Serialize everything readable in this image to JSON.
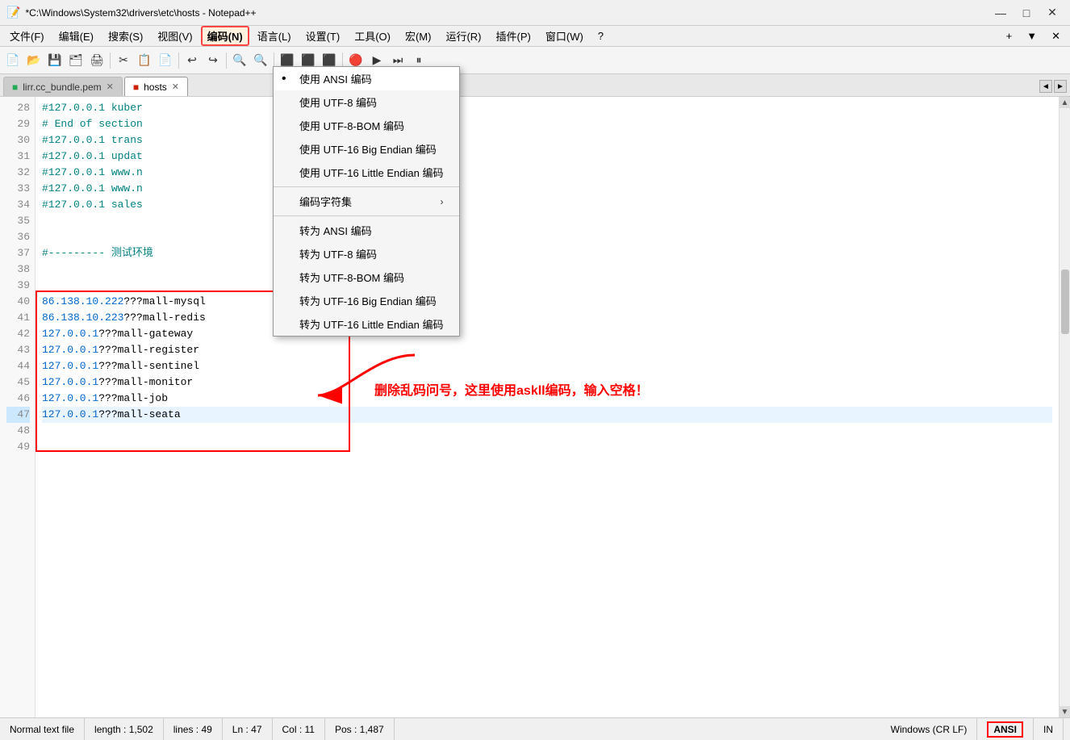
{
  "window": {
    "title": "*C:\\Windows\\System32\\drivers\\etc\\hosts - Notepad++",
    "icon": "notepad-icon"
  },
  "title_controls": {
    "minimize": "—",
    "maximize": "□",
    "close": "✕"
  },
  "menu_bar": {
    "items": [
      "文件(F)",
      "编辑(E)",
      "搜索(S)",
      "视图(V)",
      "编码(N)",
      "语言(L)",
      "设置(T)",
      "工具(O)",
      "宏(M)",
      "运行(R)",
      "插件(P)",
      "窗口(W)",
      "?"
    ]
  },
  "toolbar": {
    "buttons": [
      "📄",
      "📂",
      "💾",
      "💾",
      "🖨",
      "✂",
      "📋",
      "📄",
      "↩",
      "↪",
      "🔍",
      "🔍",
      "⬛",
      "⬛",
      "⬛",
      "🔴",
      "▶",
      "⏭",
      "⏸"
    ]
  },
  "encoding_menu_label": "编码(N)",
  "tabs": [
    {
      "name": "lirr.cc_bundle.pem",
      "active": false,
      "modified": false
    },
    {
      "name": "hosts",
      "active": true,
      "modified": true
    }
  ],
  "lines": [
    {
      "num": 28,
      "text": "#127.0.0.1 kuber"
    },
    {
      "num": 29,
      "text": "# End of section"
    },
    {
      "num": 30,
      "text": "#127.0.0.1 trans"
    },
    {
      "num": 31,
      "text": "#127.0.0.1 updat"
    },
    {
      "num": 32,
      "text": "#127.0.0.1 www.n"
    },
    {
      "num": 33,
      "text": "#127.0.0.1 www.n"
    },
    {
      "num": 34,
      "text": "#127.0.0.1 sales"
    },
    {
      "num": 35,
      "text": ""
    },
    {
      "num": 36,
      "text": ""
    },
    {
      "num": 37,
      "text": "#--------- 测试环境"
    },
    {
      "num": 38,
      "text": ""
    },
    {
      "num": 39,
      "text": ""
    },
    {
      "num": 40,
      "text": "86.138.10.222???mall-mysql"
    },
    {
      "num": 41,
      "text": "86.138.10.223???mall-redis"
    },
    {
      "num": 42,
      "text": "127.0.0.1???mall-gateway"
    },
    {
      "num": 43,
      "text": "127.0.0.1???mall-register"
    },
    {
      "num": 44,
      "text": "127.0.0.1???mall-sentinel"
    },
    {
      "num": 45,
      "text": "127.0.0.1???mall-monitor"
    },
    {
      "num": 46,
      "text": "127.0.0.1???mall-job"
    },
    {
      "num": 47,
      "text": "127.0.0.1???mall-seata"
    },
    {
      "num": 48,
      "text": ""
    },
    {
      "num": 49,
      "text": ""
    }
  ],
  "context_menu": {
    "title": "encoding-menu",
    "items": [
      {
        "label": "使用 ANSI 编码",
        "active": true,
        "has_bullet": true,
        "has_arrow": false,
        "separator_after": false
      },
      {
        "label": "使用 UTF-8 编码",
        "active": false,
        "has_bullet": false,
        "has_arrow": false,
        "separator_after": false
      },
      {
        "label": "使用 UTF-8-BOM 编码",
        "active": false,
        "has_bullet": false,
        "has_arrow": false,
        "separator_after": false
      },
      {
        "label": "使用 UTF-16 Big Endian 编码",
        "active": false,
        "has_bullet": false,
        "has_arrow": false,
        "separator_after": false
      },
      {
        "label": "使用 UTF-16 Little Endian 编码",
        "active": false,
        "has_bullet": false,
        "has_arrow": false,
        "separator_after": false
      },
      {
        "label": "SEPARATOR",
        "active": false,
        "has_bullet": false,
        "has_arrow": false,
        "separator_after": false
      },
      {
        "label": "编码字符集",
        "active": false,
        "has_bullet": false,
        "has_arrow": true,
        "separator_after": false
      },
      {
        "label": "SEPARATOR",
        "active": false,
        "has_bullet": false,
        "has_arrow": false,
        "separator_after": false
      },
      {
        "label": "转为 ANSI 编码",
        "active": false,
        "has_bullet": false,
        "has_arrow": false,
        "separator_after": false
      },
      {
        "label": "转为 UTF-8 编码",
        "active": false,
        "has_bullet": false,
        "has_arrow": false,
        "separator_after": false
      },
      {
        "label": "转为 UTF-8-BOM 编码",
        "active": false,
        "has_bullet": false,
        "has_arrow": false,
        "separator_after": false
      },
      {
        "label": "转为 UTF-16 Big Endian 编码",
        "active": false,
        "has_bullet": false,
        "has_arrow": false,
        "separator_after": false
      },
      {
        "label": "转为 UTF-16 Little Endian 编码",
        "active": false,
        "has_bullet": false,
        "has_arrow": false,
        "separator_after": false
      }
    ]
  },
  "annotation": {
    "text": "删除乱码问号，这里使用askll编码，输入空格！",
    "color": "#ff0000"
  },
  "status_bar": {
    "file_type": "Normal text file",
    "length": "length : 1,502",
    "lines": "lines : 49",
    "ln": "Ln : 47",
    "col": "Col : 11",
    "pos": "Pos : 1,487",
    "line_ending": "Windows (CR LF)",
    "encoding": "ANSI",
    "mode": "IN"
  }
}
